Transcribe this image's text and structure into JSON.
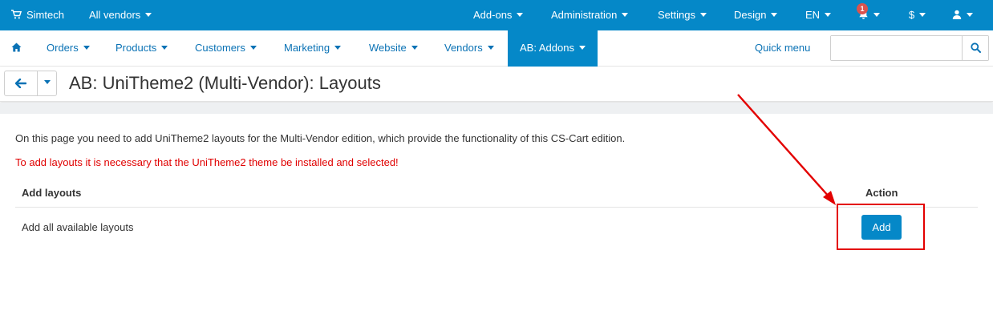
{
  "topbar": {
    "store": "Simtech",
    "vendors": "All vendors",
    "menus": [
      "Add-ons",
      "Administration",
      "Settings",
      "Design"
    ],
    "language": "EN",
    "notifications_count": "1",
    "currency": "$"
  },
  "nav": {
    "items": [
      "Orders",
      "Products",
      "Customers",
      "Marketing",
      "Website",
      "Vendors"
    ],
    "active": "AB: Addons",
    "quick_menu": "Quick menu",
    "search_value": ""
  },
  "page": {
    "title": "AB: UniTheme2 (Multi-Vendor): Layouts",
    "info": "On this page you need to add UniTheme2 layouts for the Multi-Vendor edition, which provide the functionality of this CS-Cart edition.",
    "warning": "To add layouts it is necessary that the UniTheme2 theme be installed and selected!"
  },
  "table": {
    "headers": [
      "Add layouts",
      "Action"
    ],
    "rows": [
      {
        "label": "Add all available layouts",
        "action": "Add"
      }
    ]
  },
  "colors": {
    "brand": "#0588c8",
    "link": "#0a72b5",
    "warning": "#e00000",
    "annotation": "#e30000"
  }
}
